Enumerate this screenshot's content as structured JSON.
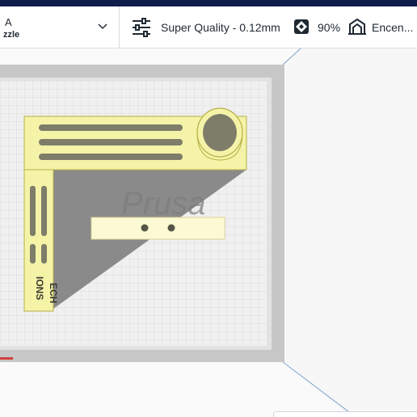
{
  "header": {
    "printer": {
      "name": "A",
      "nozzle": "zzle"
    },
    "profile": {
      "quality": "Super Quality - 0.12mm",
      "infill": "90%",
      "adhesion": "Encen..."
    }
  },
  "model": {
    "text_rotated_1": "ECH",
    "text_rotated_2": "IONS"
  },
  "colors": {
    "title_bar": "#0f1d4a",
    "model_fill": "#f5f3a7",
    "model_stroke": "#b6b04a",
    "plate": "#f0f0f0",
    "grid": "#dcdcdc",
    "shadow": "#8a8a8a",
    "wall_line": "#7da3cf"
  },
  "icons": {
    "chevron": "chevron-down-icon",
    "settings": "sliders-icon",
    "infill": "infill-icon",
    "adhesion": "adhesion-icon"
  }
}
